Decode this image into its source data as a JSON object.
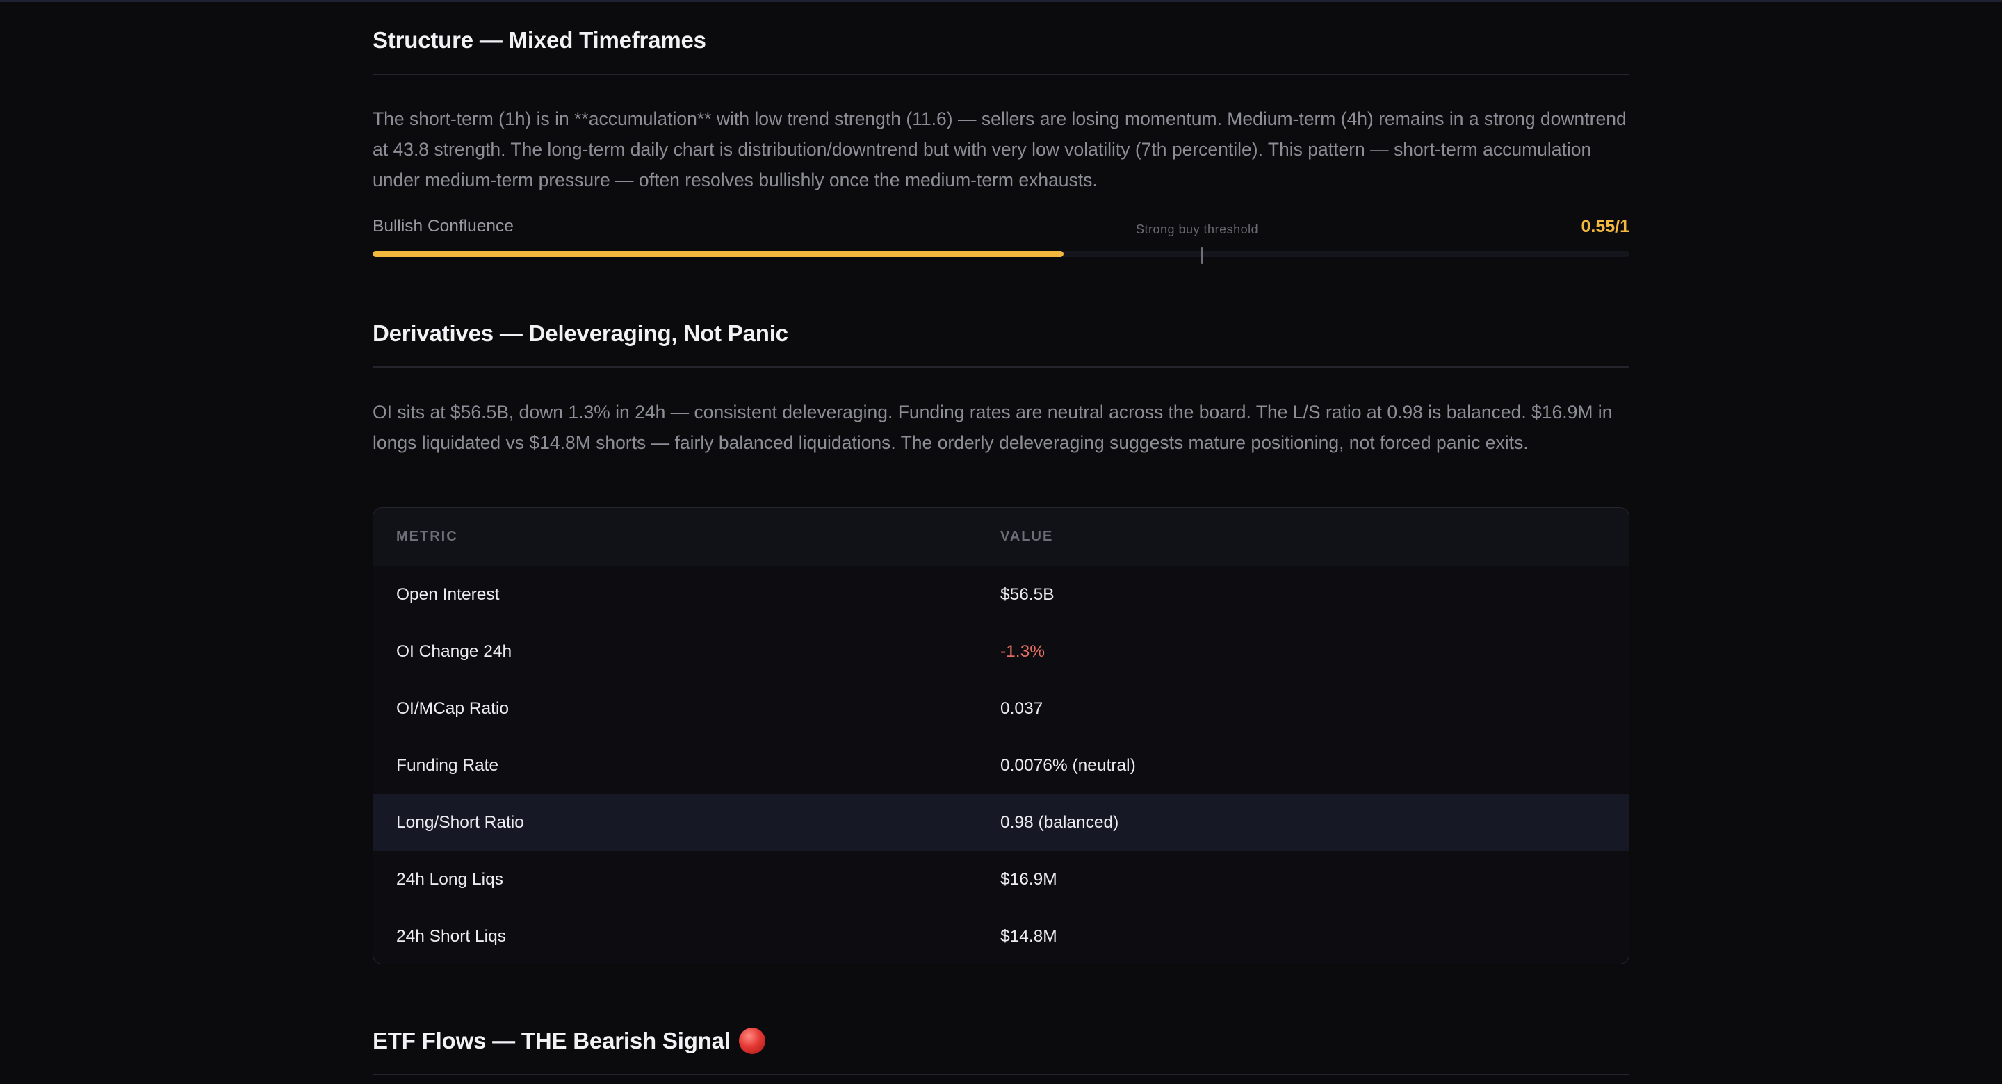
{
  "structure": {
    "title": "Structure — Mixed Timeframes",
    "paragraph": "The short-term (1h) is in **accumulation** with low trend strength (11.6) — sellers are losing momentum. Medium-term (4h) remains in a strong downtrend at 43.8 strength. The long-term daily chart is distribution/downtrend but with very low volatility (7th percentile). This pattern — short-term accumulation under medium-term pressure — often resolves bullishly once the medium-term exhausts.",
    "confluence_label": "Bullish Confluence",
    "threshold_label": "Strong buy threshold",
    "confluence_value": "0.55/1",
    "confluence_fraction": 0.55,
    "threshold_fraction": 0.66,
    "accent_color": "#f2b83e"
  },
  "derivatives": {
    "title": "Derivatives — Deleveraging, Not Panic",
    "paragraph": "OI sits at $56.5B, down 1.3% in 24h — consistent deleveraging. Funding rates are neutral across the board. The L/S ratio at 0.98 is balanced. $16.9M in longs liquidated vs $14.8M shorts — fairly balanced liquidations. The orderly deleveraging suggests mature positioning, not forced panic exits.",
    "table": {
      "headers": [
        "METRIC",
        "VALUE"
      ],
      "rows": [
        {
          "metric": "Open Interest",
          "value": "$56.5B"
        },
        {
          "metric": "OI Change 24h",
          "value": "-1.3%"
        },
        {
          "metric": "OI/MCap Ratio",
          "value": "0.037"
        },
        {
          "metric": "Funding Rate",
          "value": "0.0076% (neutral)"
        },
        {
          "metric": "Long/Short Ratio",
          "value": "0.98 (balanced)"
        },
        {
          "metric": "24h Long Liqs",
          "value": "$16.9M"
        },
        {
          "metric": "24h Short Liqs",
          "value": "$14.8M"
        }
      ],
      "negative_color": "#e26d62"
    }
  },
  "etf": {
    "title": "ETF Flows — THE Bearish Signal",
    "title_icon": "red-circle-icon"
  }
}
